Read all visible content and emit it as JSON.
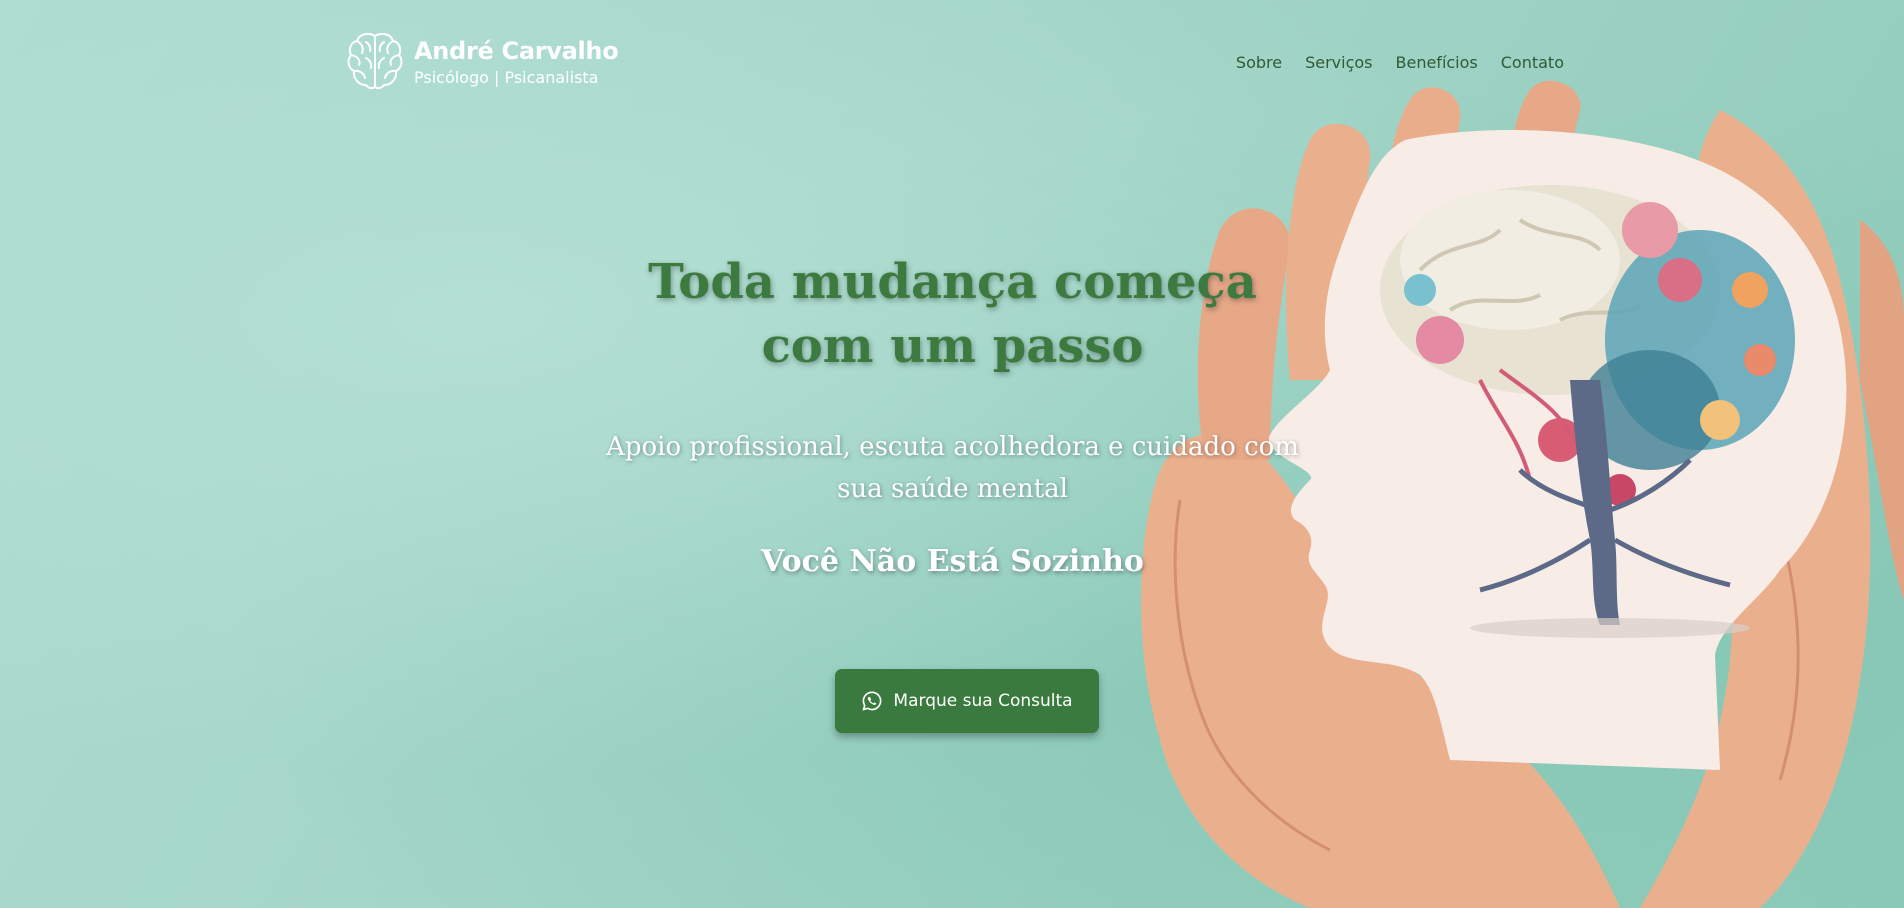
{
  "brand": {
    "name": "André Carvalho",
    "subtitle": "Psicólogo | Psicanalista",
    "logo_icon": "brain-icon"
  },
  "nav": {
    "items": [
      {
        "label": "Sobre"
      },
      {
        "label": "Serviços"
      },
      {
        "label": "Benefícios"
      },
      {
        "label": "Contato"
      }
    ]
  },
  "hero": {
    "headline_line1": "Toda mudança começa",
    "headline_line2": "com um passo",
    "subtitle_line1": "Apoio profissional, escuta acolhedora e cuidado com",
    "subtitle_line2": "sua saúde mental",
    "tagline": "Você Não Está Sozinho",
    "cta_label": "Marque sua Consulta",
    "cta_icon": "whatsapp-icon"
  },
  "colors": {
    "background": "#a9d8cb",
    "accent_green": "#3a7a3e",
    "nav_text": "#2f5b35",
    "headline": "#3d7a40"
  }
}
